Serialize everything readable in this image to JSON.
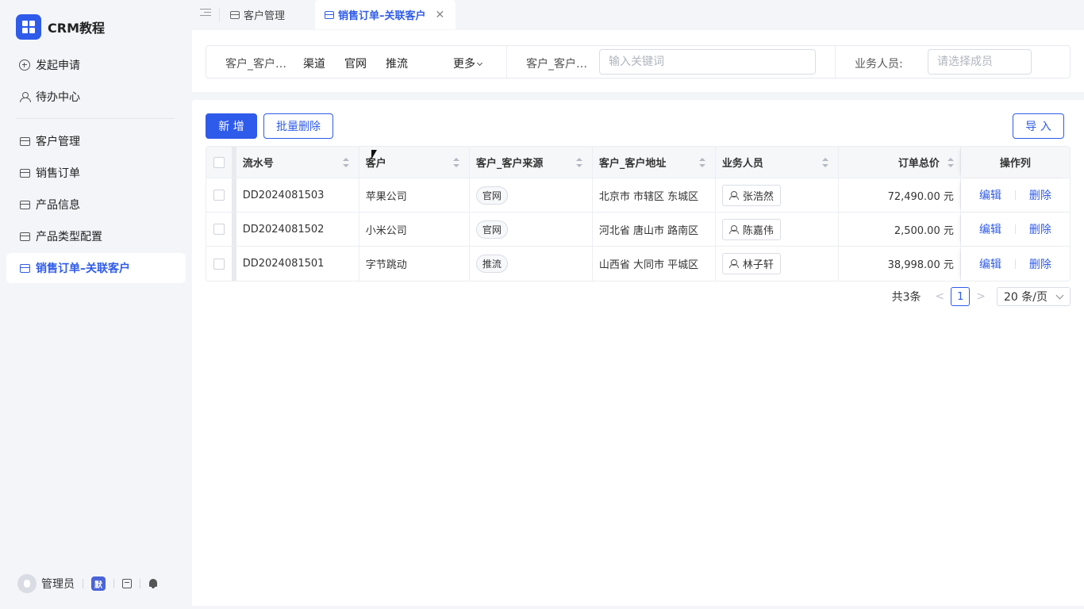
{
  "app": {
    "title": "CRM教程"
  },
  "sidebar": {
    "items": [
      {
        "label": "发起申请",
        "icon": "plus-circle-icon"
      },
      {
        "label": "待办中心",
        "icon": "user-icon"
      },
      {
        "label": "客户管理",
        "icon": "card-icon"
      },
      {
        "label": "销售订单",
        "icon": "card-icon"
      },
      {
        "label": "产品信息",
        "icon": "card-icon"
      },
      {
        "label": "产品类型配置",
        "icon": "card-icon"
      },
      {
        "label": "销售订单–关联客户",
        "icon": "card-icon",
        "active": true
      }
    ],
    "user": {
      "name": "管理员",
      "lang_badge": "默"
    }
  },
  "tabs": [
    {
      "label": "客户管理",
      "active": false
    },
    {
      "label": "销售订单–关联客户",
      "active": true,
      "close": "✕"
    }
  ],
  "filter": {
    "source_label": "客户_客户…",
    "options": [
      "渠道",
      "官网",
      "推流"
    ],
    "more_label": "更多",
    "keyword_label": "客户_客户…",
    "keyword_placeholder": "输入关键词",
    "sales_label": "业务人员:",
    "sales_placeholder": "请选择成员"
  },
  "toolbar": {
    "add_label": "新 增",
    "batch_delete_label": "批量删除",
    "import_label": "导 入"
  },
  "table": {
    "columns": [
      "流水号",
      "客户",
      "客户_客户来源",
      "客户_客户地址",
      "业务人员",
      "订单总价",
      "操作列"
    ],
    "rows": [
      {
        "no": "DD2024081503",
        "customer": "苹果公司",
        "source": "官网",
        "address": "北京市 市辖区 东城区",
        "sales": "张浩然",
        "total": "72,490.00 元",
        "edit": "编辑",
        "delete": "删除"
      },
      {
        "no": "DD2024081502",
        "customer": "小米公司",
        "source": "官网",
        "address": "河北省 唐山市 路南区",
        "sales": "陈嘉伟",
        "total": "2,500.00 元",
        "edit": "编辑",
        "delete": "删除"
      },
      {
        "no": "DD2024081501",
        "customer": "字节跳动",
        "source": "推流",
        "address": "山西省 大同市 平城区",
        "sales": "林子轩",
        "total": "38,998.00 元",
        "edit": "编辑",
        "delete": "删除"
      }
    ]
  },
  "pagination": {
    "total_text": "共3条",
    "prev": "<",
    "current_page": "1",
    "next": ">",
    "page_size": "20 条/页"
  },
  "colors": {
    "accent": "#2f5bea",
    "sidebar_bg": "#f3f5f8"
  }
}
